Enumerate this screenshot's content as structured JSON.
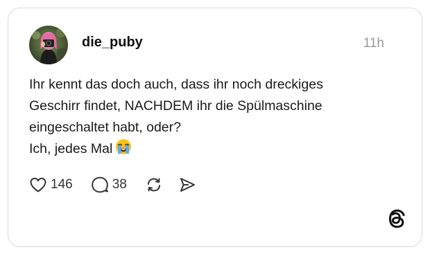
{
  "post": {
    "username": "die_puby",
    "time": "11h",
    "lines": [
      "Ihr kennt das doch auch, dass ihr noch dreckiges",
      "Geschirr findet, NACHDEM ihr die Spülmaschine",
      "eingeschaltet habt, oder?",
      "Ich, jedes Mal"
    ],
    "emoji": "loudly-crying-face"
  },
  "actions": {
    "likes": "146",
    "replies": "38"
  },
  "icons": {
    "like": "heart-icon",
    "reply": "comment-bubble-icon",
    "repost": "repost-icon",
    "share": "send-icon",
    "brand": "threads-logo-icon"
  },
  "colors": {
    "text": "#111111",
    "muted": "#999999",
    "border": "#d9d9d9"
  }
}
